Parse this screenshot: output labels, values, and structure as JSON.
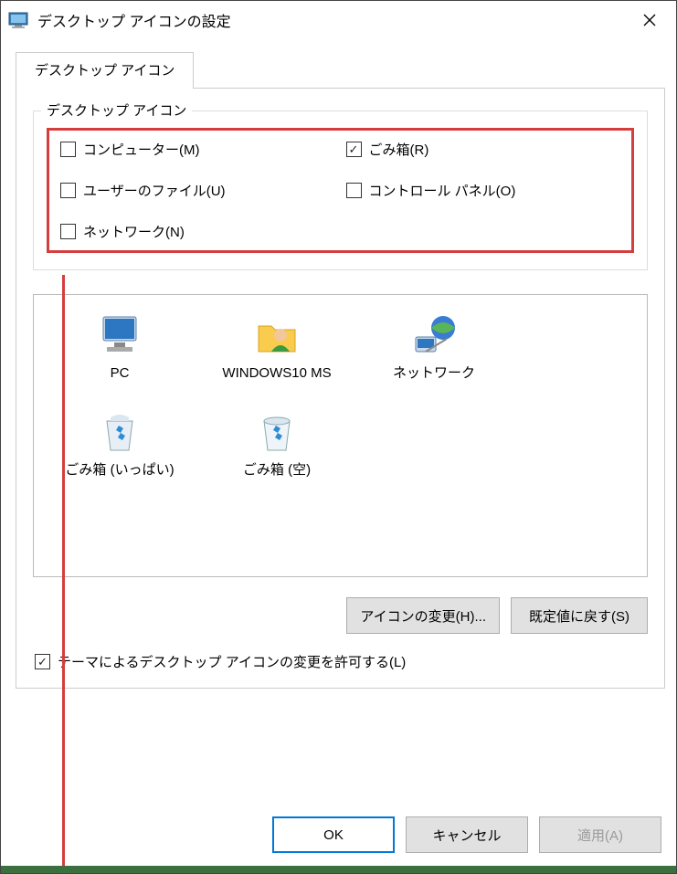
{
  "window": {
    "title": "デスクトップ アイコンの設定"
  },
  "tab": {
    "label": "デスクトップ アイコン"
  },
  "group": {
    "label": "デスクトップ アイコン",
    "items": [
      {
        "label": "コンピューター(M)",
        "checked": false
      },
      {
        "label": "ごみ箱(R)",
        "checked": true
      },
      {
        "label": "ユーザーのファイル(U)",
        "checked": false
      },
      {
        "label": "コントロール パネル(O)",
        "checked": false
      },
      {
        "label": "ネットワーク(N)",
        "checked": false
      }
    ]
  },
  "preview": {
    "items": [
      {
        "label": "PC",
        "icon": "pc"
      },
      {
        "label": "WINDOWS10 MS",
        "icon": "user"
      },
      {
        "label": "ネットワーク",
        "icon": "network"
      },
      {
        "label": "ごみ箱 (いっぱい)",
        "icon": "recycle-full"
      },
      {
        "label": "ごみ箱 (空)",
        "icon": "recycle-empty"
      }
    ]
  },
  "buttons": {
    "change_icon": "アイコンの変更(H)...",
    "restore_default": "既定値に戻す(S)"
  },
  "theme_checkbox": {
    "label": "テーマによるデスクトップ アイコンの変更を許可する(L)",
    "checked": true
  },
  "dialog": {
    "ok": "OK",
    "cancel": "キャンセル",
    "apply": "適用(A)"
  }
}
